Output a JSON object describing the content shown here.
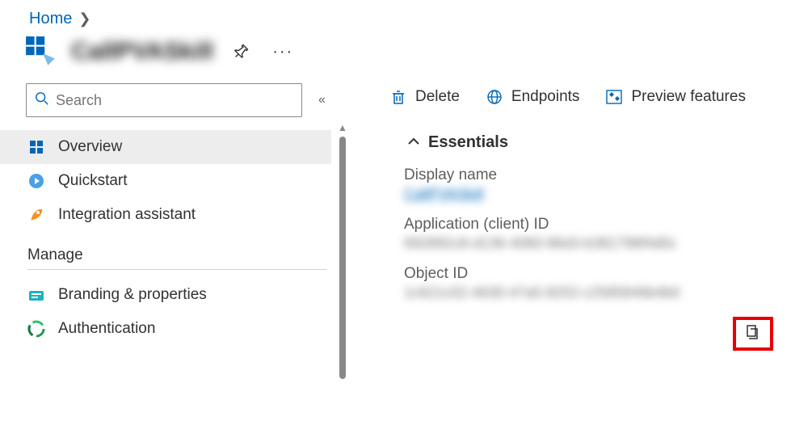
{
  "breadcrumb": {
    "home": "Home"
  },
  "header": {
    "title": "CallPVASkill"
  },
  "sidebar": {
    "search_placeholder": "Search",
    "items": {
      "overview": "Overview",
      "quickstart": "Quickstart",
      "integration": "Integration assistant"
    },
    "section_manage": "Manage",
    "manage_items": {
      "branding": "Branding & properties",
      "auth": "Authentication"
    }
  },
  "toolbar": {
    "delete": "Delete",
    "endpoints": "Endpoints",
    "preview": "Preview features"
  },
  "essentials": {
    "title": "Essentials",
    "display_name_label": "Display name",
    "display_name_value": "CallPVASkill",
    "app_id_label": "Application (client) ID",
    "app_id_value": "692892c8-d136-4060-86d3-b381798f4d0c",
    "object_id_label": "Object ID",
    "object_id_value": "1c621c02-4630-47a5-8252-c2585846b4b0"
  }
}
